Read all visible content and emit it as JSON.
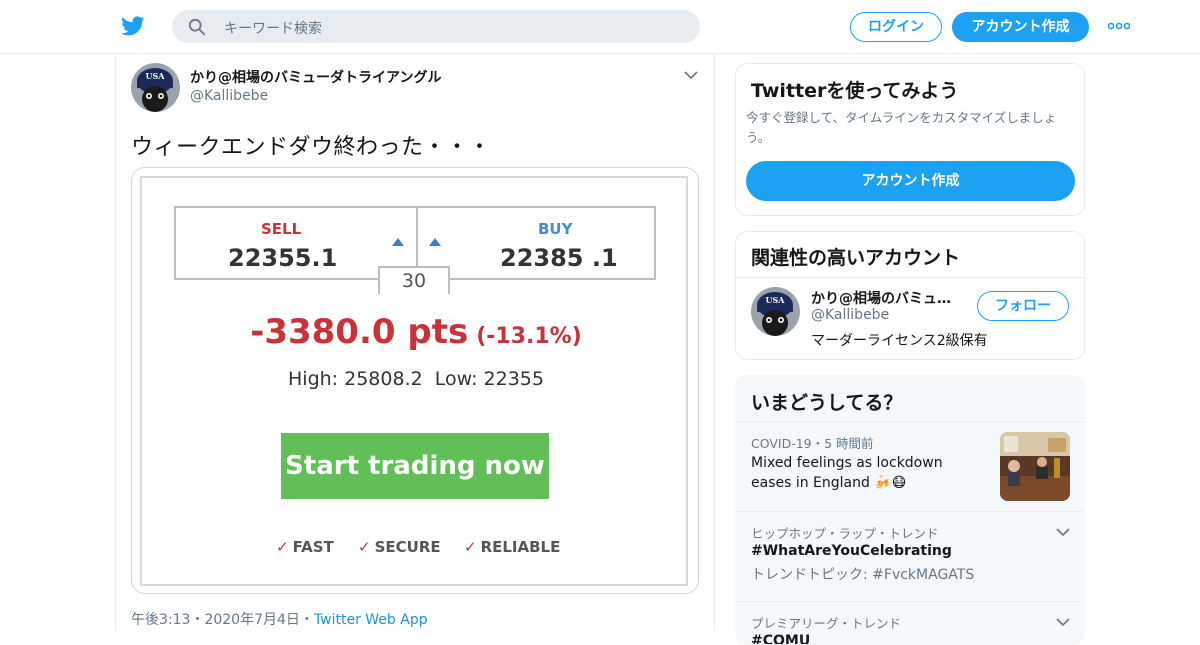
{
  "header": {
    "search_placeholder": "キーワード検索",
    "login_label": "ログイン",
    "signup_label": "アカウント作成",
    "brand_color": "#1da1f2"
  },
  "tweet": {
    "author_name": "かり@相場のバミューダトライアングル",
    "author_handle": "@Kallibebe",
    "avatar_text": "USA",
    "text": "ウィークエンドダウ終わった・・・",
    "time": "午後3:13",
    "date": "2020年7月4日",
    "source": "Twitter Web App",
    "sep": "・"
  },
  "media": {
    "sell_label": "SELL",
    "sell_value": "22355.1",
    "buy_label": "BUY",
    "buy_value": "22385 .1",
    "spread": "30",
    "change": "-3380.0 pts",
    "change_pct": "(-13.1%)",
    "high": "High: 25808.2",
    "low": "Low: 22355",
    "cta": "Start trading now",
    "features": [
      "FAST",
      "SECURE",
      "RELIABLE"
    ],
    "check": "✓"
  },
  "sidebar": {
    "try_title": "Twitterを使ってみよう",
    "try_desc": "今すぐ登録して、タイムラインをカスタマイズしましょう。",
    "try_button": "アカウント作成",
    "related_title": "関連性の高いアカウント",
    "related": {
      "name": "かり@相場のバミュ…",
      "handle": "@Kallibebe",
      "bio": "マーダーライセンス2級保有",
      "follow_label": "フォロー"
    },
    "trends_title": "いまどうしてる？",
    "trends": [
      {
        "context": "COVID-19・5 時間前",
        "title": "Mixed feelings as lockdown eases in England 🍻😷"
      },
      {
        "context": "ヒップホップ・ラップ・トレンド",
        "title": "#WhatAreYouCelebrating",
        "sub": "トレンドトピック: #FvckMAGATS"
      },
      {
        "context": "プレミアリーグ・トレンド",
        "title": "#COMU"
      }
    ]
  }
}
